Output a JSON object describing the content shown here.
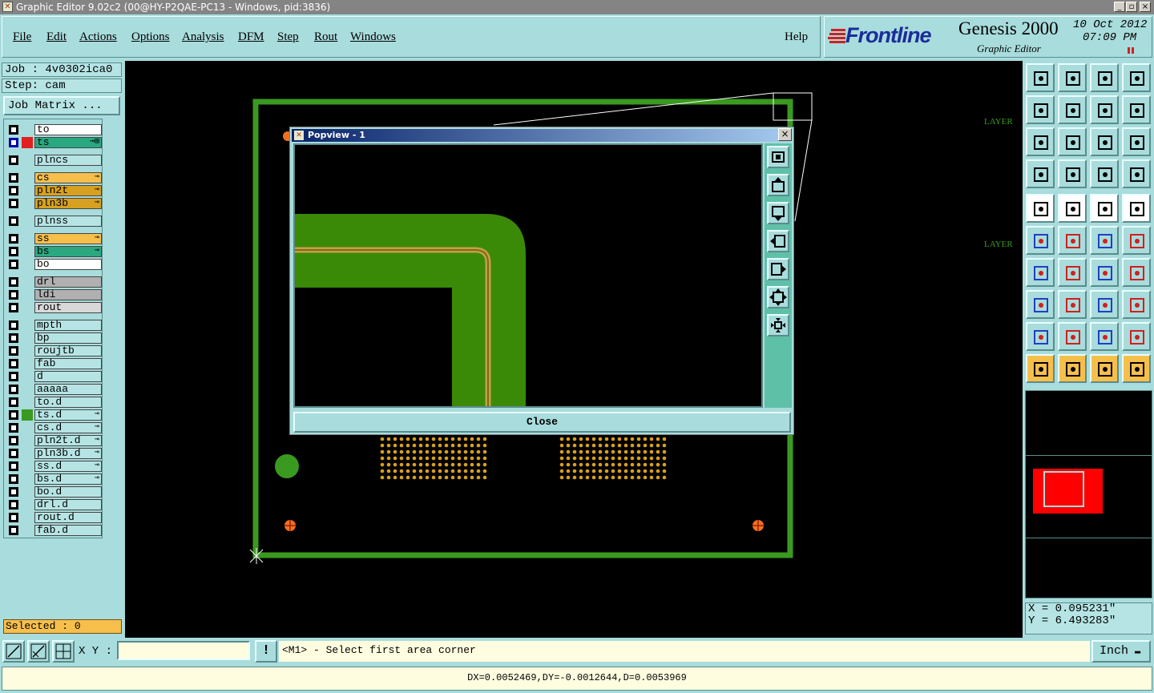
{
  "window": {
    "title": "Graphic Editor 9.02c2 (00@HY-P2QAE-PC13 - Windows, pid:3836)"
  },
  "menu": {
    "items": [
      "File",
      "Edit",
      "Actions",
      "Options",
      "Analysis",
      "DFM",
      "Step",
      "Rout",
      "Windows"
    ],
    "help": "Help"
  },
  "brand": {
    "logo": "Frontline",
    "product": "Genesis 2000",
    "subtitle": "Graphic Editor",
    "date": "10 Oct 2012",
    "time": "07:09 PM"
  },
  "job": {
    "job_label": "Job : 4v0302ica0",
    "step_label": "Step: cam",
    "matrix_button": "Job Matrix ..."
  },
  "layers": [
    {
      "name": "to",
      "bg": "#ffffff",
      "color": "",
      "mark": ""
    },
    {
      "name": "ts",
      "bg": "#2aa880",
      "color": "#e02020",
      "mark": "⊸⊞",
      "chk": "#0000aa"
    },
    {
      "name": "plncs",
      "bg": "#b6e4e4",
      "color": "",
      "mark": ""
    },
    {
      "name": "cs",
      "bg": "#f6bf4c",
      "color": "",
      "mark": "⊸"
    },
    {
      "name": "pln2t",
      "bg": "#d8a020",
      "color": "",
      "mark": "⊸"
    },
    {
      "name": "pln3b",
      "bg": "#d8a020",
      "color": "",
      "mark": "⊸"
    },
    {
      "name": "plnss",
      "bg": "#b6e4e4",
      "color": "",
      "mark": ""
    },
    {
      "name": "ss",
      "bg": "#f6bf4c",
      "color": "",
      "mark": "⊸"
    },
    {
      "name": "bs",
      "bg": "#2aa880",
      "color": "",
      "mark": "⊸"
    },
    {
      "name": "bo",
      "bg": "#ffffff",
      "color": "",
      "mark": ""
    },
    {
      "name": "drl",
      "bg": "#b0b0b0",
      "color": "",
      "mark": ""
    },
    {
      "name": "ldi",
      "bg": "#b0b0b0",
      "color": "",
      "mark": ""
    },
    {
      "name": "rout",
      "bg": "#d8d8d8",
      "color": "",
      "mark": ""
    },
    {
      "name": "mpth",
      "bg": "#b6e4e4",
      "color": "",
      "mark": ""
    },
    {
      "name": "bp",
      "bg": "#b6e4e4",
      "color": "",
      "mark": ""
    },
    {
      "name": "roujtb",
      "bg": "#b6e4e4",
      "color": "",
      "mark": ""
    },
    {
      "name": "fab",
      "bg": "#b6e4e4",
      "color": "",
      "mark": ""
    },
    {
      "name": "d",
      "bg": "#b6e4e4",
      "color": "",
      "mark": ""
    },
    {
      "name": "aaaaa",
      "bg": "#b6e4e4",
      "color": "",
      "mark": ""
    },
    {
      "name": "to.d",
      "bg": "#b6e4e4",
      "color": "",
      "mark": ""
    },
    {
      "name": "ts.d",
      "bg": "#b6e4e4",
      "color": "#3a9a20",
      "mark": "⊸"
    },
    {
      "name": "cs.d",
      "bg": "#b6e4e4",
      "color": "",
      "mark": "⊸"
    },
    {
      "name": "pln2t.d",
      "bg": "#b6e4e4",
      "color": "",
      "mark": "⊸"
    },
    {
      "name": "pln3b.d",
      "bg": "#b6e4e4",
      "color": "",
      "mark": "⊸"
    },
    {
      "name": "ss.d",
      "bg": "#b6e4e4",
      "color": "",
      "mark": "⊸"
    },
    {
      "name": "bs.d",
      "bg": "#b6e4e4",
      "color": "",
      "mark": "⊸"
    },
    {
      "name": "bo.d",
      "bg": "#b6e4e4",
      "color": "",
      "mark": ""
    },
    {
      "name": "drl.d",
      "bg": "#b6e4e4",
      "color": "",
      "mark": ""
    },
    {
      "name": "rout.d",
      "bg": "#b6e4e4",
      "color": "",
      "mark": ""
    },
    {
      "name": "fab.d",
      "bg": "#b6e4e4",
      "color": "",
      "mark": ""
    }
  ],
  "selected_label": "Selected : 0",
  "canvas": {
    "layer_label_1": "LAYER",
    "layer_label_2": "LAYER"
  },
  "popview": {
    "title": "Popview - 1",
    "close_label": "Close",
    "close_x": "×"
  },
  "coords": {
    "x": "X = 0.095231\"",
    "y": "Y = 6.493283\""
  },
  "bottom": {
    "xy_label": "X Y :",
    "prompt": "<M1> - Select first area corner",
    "unit": "Inch",
    "alert": "!"
  },
  "status": {
    "text": "DX=0.0052469,DY=-0.0012644,D=0.0053969"
  }
}
